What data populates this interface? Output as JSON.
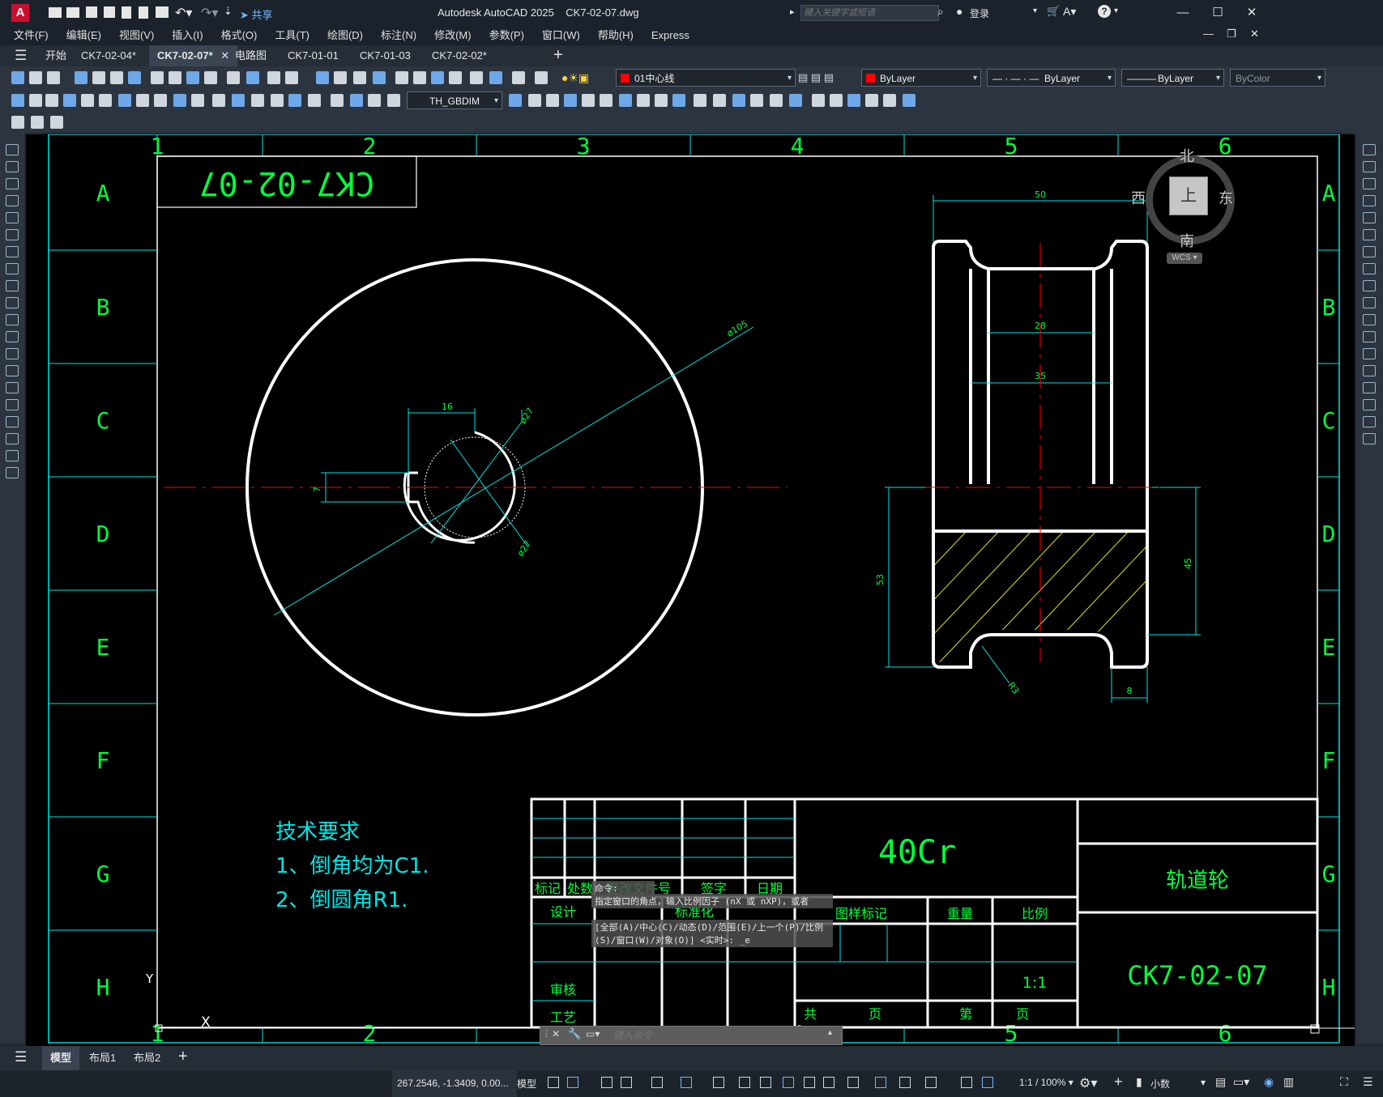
{
  "app": {
    "title": "Autodesk AutoCAD 2025",
    "file": "CK7-02-07.dwg",
    "search_placeholder": "键入关键字或短语",
    "login": "登录",
    "share": "共享"
  },
  "menu": [
    "文件(F)",
    "编辑(E)",
    "视图(V)",
    "插入(I)",
    "格式(O)",
    "工具(T)",
    "绘图(D)",
    "标注(N)",
    "修改(M)",
    "参数(P)",
    "窗口(W)",
    "帮助(H)",
    "Express"
  ],
  "tabs": [
    {
      "label": "开始",
      "active": false
    },
    {
      "label": "CK7-02-04*",
      "active": false
    },
    {
      "label": "CK7-02-07*",
      "active": true
    },
    {
      "label": "电路图",
      "active": false
    },
    {
      "label": "CK7-01-01",
      "active": false
    },
    {
      "label": "CK7-01-03",
      "active": false
    },
    {
      "label": "CK7-02-02*",
      "active": false
    }
  ],
  "toolbar": {
    "layer": "01中心线",
    "color": "ByLayer",
    "linetype": "ByLayer",
    "lineweight": "ByLayer",
    "plotstyle": "ByColor",
    "dimstyle": "TH_GBDIM",
    "layer_color": "#ff0000"
  },
  "viewcube": {
    "north": "北",
    "south": "南",
    "east": "东",
    "west": "西",
    "face": "上",
    "wcs": "WCS"
  },
  "drawing": {
    "frame_columns": [
      "1",
      "2",
      "3",
      "4",
      "5",
      "6"
    ],
    "frame_rows": [
      "A",
      "B",
      "C",
      "D",
      "E",
      "F",
      "G",
      "H"
    ],
    "code_box": "CK7-02-07",
    "dims_left": {
      "d105": "ø105",
      "d27a": "ø27",
      "d27b": "ø27",
      "w16": "16",
      "h7": "7"
    },
    "dims_right": {
      "w50": "50",
      "w28": "28",
      "w35": "35",
      "h53": "53",
      "h45": "45",
      "r3": "R3",
      "w8": "8"
    },
    "tech_title": "技术要求",
    "tech_1": "1、倒角均为C1.",
    "tech_2": "2、倒圆角R1.",
    "material": "40Cr",
    "part_name": "轨道轮",
    "part_code": "CK7-02-07",
    "tb_headers": [
      "标记",
      "处数",
      "更改文件号",
      "签字",
      "日期"
    ],
    "tb_design": "设计",
    "tb_standard": "标准化",
    "tb_check": "审核",
    "tb_process": "工艺",
    "tb_mark": "图样标记",
    "tb_weight": "重量",
    "tb_scale": "比例",
    "tb_scale_val": "1:1",
    "tb_total": "共",
    "tb_page": "页",
    "tb_no": "第",
    "tb_page2": "页",
    "ucs_y": "Y",
    "ucs_x": "X"
  },
  "command": {
    "line1": "命令: '_.zoom",
    "line2": "指定窗口的角点，输入比例因子 (nX 或 nXP)，或者",
    "line3": "[全部(A)/中心(C)/动态(D)/范围(E)/上一个(P)/比例(S)/窗口(W)/对象(O)] <实时>: _e",
    "placeholder": "键入命令"
  },
  "layouts": [
    {
      "label": "模型",
      "active": true
    },
    {
      "label": "布局1",
      "active": false
    },
    {
      "label": "布局2",
      "active": false
    }
  ],
  "status": {
    "coords": "267.2546, -1.3409, 0.00...",
    "model": "模型",
    "scale": "1:1 / 100%",
    "units": "小数"
  }
}
